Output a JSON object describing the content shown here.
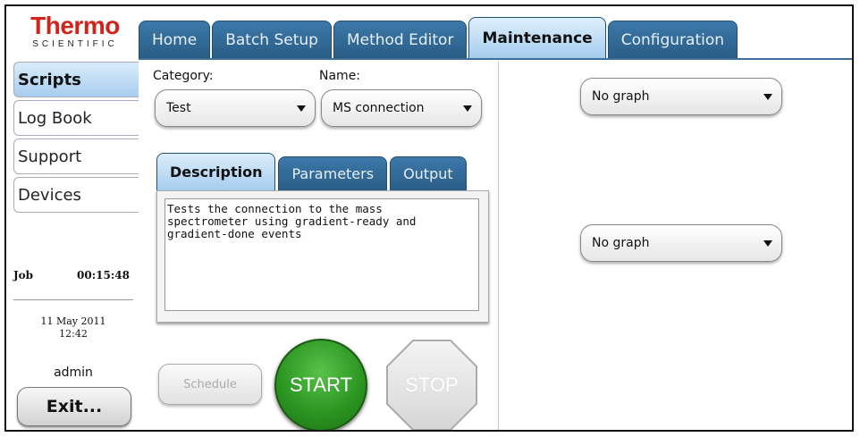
{
  "logo": {
    "brand": "Thermo",
    "sub": "SCIENTIFIC"
  },
  "top_tabs": [
    {
      "label": "Home",
      "active": false
    },
    {
      "label": "Batch Setup",
      "active": false
    },
    {
      "label": "Method Editor",
      "active": false
    },
    {
      "label": "Maintenance",
      "active": true
    },
    {
      "label": "Configuration",
      "active": false
    }
  ],
  "sidebar": {
    "items": [
      {
        "label": "Scripts",
        "active": true
      },
      {
        "label": "Log Book",
        "active": false
      },
      {
        "label": "Support",
        "active": false
      },
      {
        "label": "Devices",
        "active": false
      }
    ],
    "job_label": "Job",
    "job_time": "00:15:48",
    "date": "11 May 2011",
    "time": "12:42",
    "user": "admin",
    "exit_label": "Exit..."
  },
  "main": {
    "category_label": "Category:",
    "category_value": "Test",
    "name_label": "Name:",
    "name_value": "MS connection",
    "sub_tabs": [
      {
        "label": "Description",
        "active": true
      },
      {
        "label": "Parameters",
        "active": false
      },
      {
        "label": "Output",
        "active": false
      }
    ],
    "description": "Tests the connection to the mass\nspectrometer using gradient-ready and\ngradient-done events",
    "schedule_label": "Schedule",
    "start_label": "START",
    "stop_label": "STOP"
  },
  "graphs": {
    "graph1_value": "No graph",
    "graph2_value": "No graph"
  },
  "colors": {
    "brand_red": "#d3211c",
    "tab_blue": "#2a5d86",
    "active_tab": "#a5cdee",
    "start_green": "#2c9722"
  }
}
